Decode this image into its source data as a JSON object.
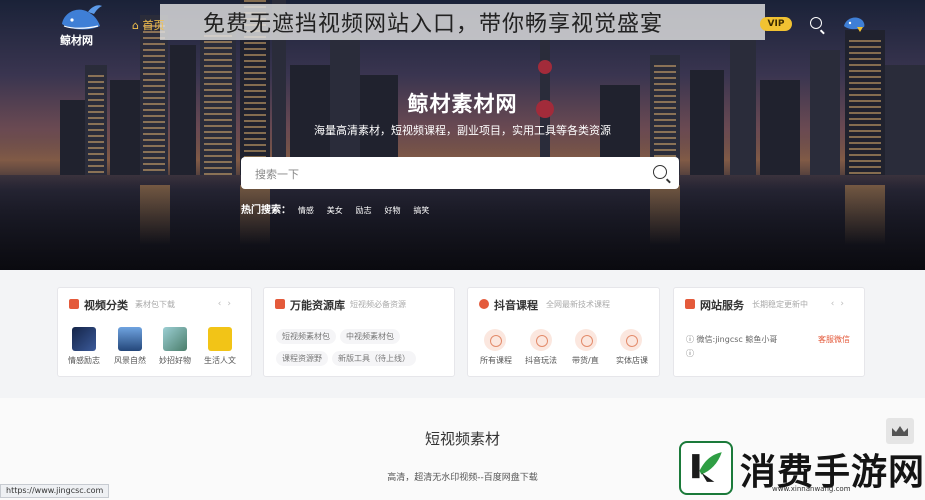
{
  "overlay_title": "免费无遮挡视频网站入口，带你畅享视觉盛宴",
  "header": {
    "logo_text": "鲸材网",
    "nav": [
      {
        "label": "⌂ 首页"
      }
    ],
    "vip_label": "VIP",
    "icons": {
      "search": "search-icon",
      "avatar": "avatar-icon"
    }
  },
  "hero": {
    "title": "鲸材素材网",
    "subtitle": "海量高清素材，短视频课程，副业项目，实用工具等各类资源",
    "search_placeholder": "搜索一下",
    "hot_label": "热门搜索：",
    "hot_keywords": [
      "情感",
      "美女",
      "励志",
      "好物",
      "搞笑"
    ]
  },
  "cards": [
    {
      "title": "视频分类",
      "subtitle": "素材包下载",
      "icon": "video-category-icon",
      "accent": "#e45a3b",
      "items": [
        {
          "label": "情感励志",
          "color": "#23355c"
        },
        {
          "label": "风景自然",
          "color": "#3a6fb5"
        },
        {
          "label": "妙招好物",
          "color": "#6aa0a8"
        },
        {
          "label": "生活人文",
          "color": "#f2c417"
        }
      ]
    },
    {
      "title": "万能资源库",
      "subtitle": "短视频必备资源",
      "icon": "resource-library-icon",
      "accent": "#e45a3b",
      "tags": [
        "短视频素材包",
        "中视频素材包",
        "课程资源野",
        "新版工具（待上线）"
      ]
    },
    {
      "title": "抖音课程",
      "subtitle": "全网最新技术课程",
      "icon": "course-icon",
      "accent": "#e45a3b",
      "items": [
        {
          "label": "所有课程"
        },
        {
          "label": "抖音玩法"
        },
        {
          "label": "带货/直"
        },
        {
          "label": "实体店课"
        }
      ]
    },
    {
      "title": "网站服务",
      "subtitle": "长期稳定更新中",
      "icon": "service-icon",
      "accent": "#e45a3b",
      "rows": [
        "微信:jingcsc 鲸鱼小哥",
        ""
      ],
      "link": "客服微信"
    }
  ],
  "section": {
    "title": "短视频素材",
    "subtitle": "高清，超清无水印视频--百度网盘下载"
  },
  "status_url": "https://www.jingcsc.com",
  "watermark": {
    "text": "消费手游网",
    "url": "www.xinnanwang.com",
    "logo": "leaf-k-logo"
  }
}
